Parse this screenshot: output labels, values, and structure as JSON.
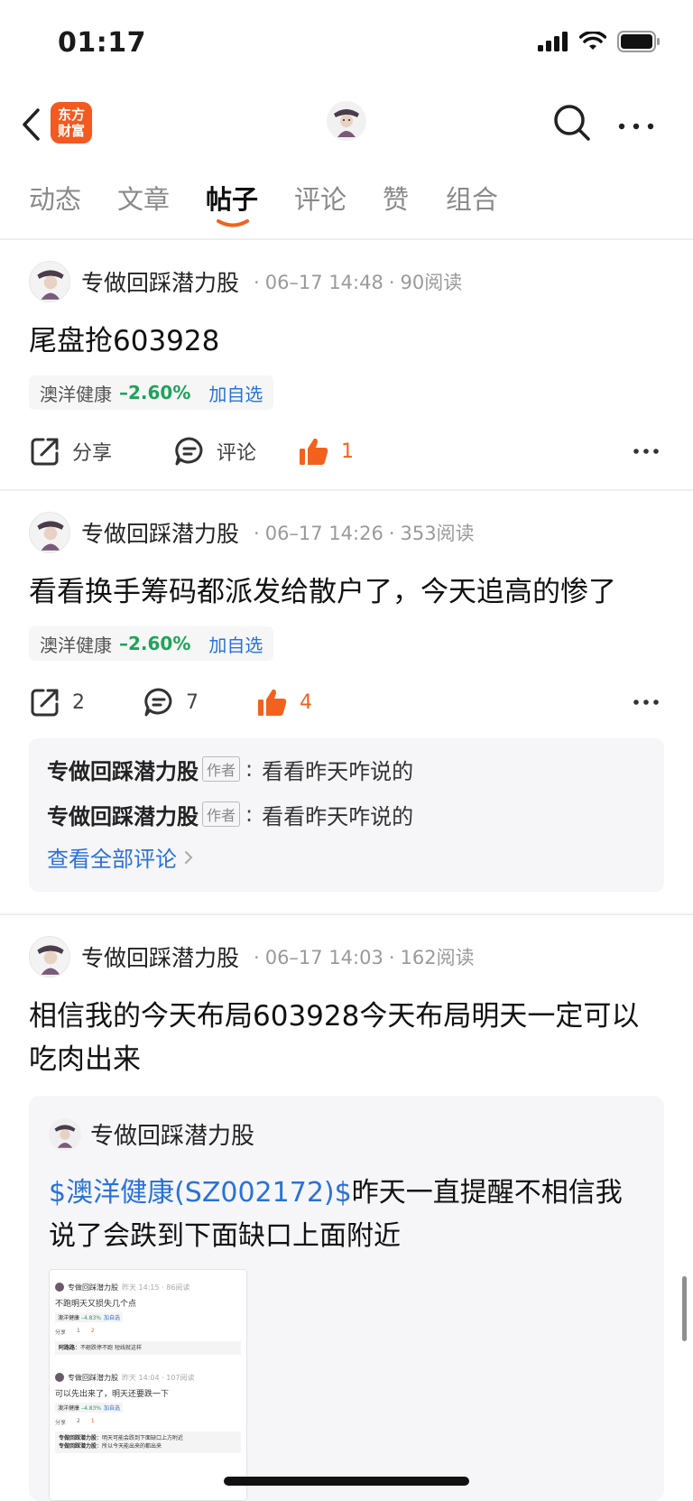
{
  "status_bar": {
    "time": "01:17"
  },
  "nav": {
    "logo_line1": "东方",
    "logo_line2": "财富",
    "brand_color": "#f25a1f"
  },
  "tabs": [
    {
      "label": "动态",
      "active": false
    },
    {
      "label": "文章",
      "active": false
    },
    {
      "label": "帖子",
      "active": true
    },
    {
      "label": "评论",
      "active": false
    },
    {
      "label": "赞",
      "active": false
    },
    {
      "label": "组合",
      "active": false
    }
  ],
  "posts": [
    {
      "author": "专做回踩潜力股",
      "time": "06–17 14:48",
      "reads": "90阅读",
      "text": "尾盘抢603928",
      "stock": {
        "name": "澳洋健康",
        "change": "–2.60%",
        "add": "加自选"
      },
      "actions": {
        "share": "分享",
        "comment": "评论",
        "like": "1"
      }
    },
    {
      "author": "专做回踩潜力股",
      "time": "06–17 14:26",
      "reads": "353阅读",
      "text": "看看换手筹码都派发给散户了，今天追高的惨了",
      "stock": {
        "name": "澳洋健康",
        "change": "–2.60%",
        "add": "加自选"
      },
      "actions": {
        "share": "2",
        "comment": "7",
        "like": "4"
      },
      "comments": [
        {
          "author": "专做回踩潜力股",
          "tag": "作者",
          "colon": ":",
          "text": "看看昨天咋说的"
        },
        {
          "author": "专做回踩潜力股",
          "tag": "作者",
          "colon": ":",
          "text": "看看昨天咋说的"
        }
      ],
      "view_all": "查看全部评论"
    },
    {
      "author": "专做回踩潜力股",
      "time": "06–17 14:03",
      "reads": "162阅读",
      "text": "相信我的今天布局603928今天布局明天一定可以吃肉出来",
      "quote": {
        "author": "专做回踩潜力股",
        "link": "$澳洋健康(SZ002172)$",
        "text": "昨天一直提醒不相信我说了会跌到下面缺口上面附近"
      }
    }
  ],
  "thumbnail": {
    "items": [
      {
        "author": "专做回踩潜力股",
        "time": "昨天 14:15 · 86阅读",
        "title": "不跑明天又损失几个点",
        "stock": "澳洋健康",
        "change": "–4.83%",
        "add": "加自选",
        "share": "分享",
        "comment": "1",
        "like": "2",
        "c_author": "阿路路",
        "c_text": "不砸跌停不跑 短线就这样"
      },
      {
        "author": "专做回踩潜力股",
        "time": "昨天 14:04 · 107阅读",
        "title": "可以先出来了，明天还要跌一下",
        "stock": "澳洋健康",
        "change": "–4.83%",
        "add": "加自选",
        "share": "分享",
        "comment": "2",
        "like": "1",
        "c_author": "专做回踩潜力股",
        "c_text": "明天可能会跌到下面缺口上方附近",
        "c_author2": "专做回踩潜力股",
        "c_text2": "所以今天能出来的都出来"
      }
    ]
  },
  "colors": {
    "green": "#1fa35a",
    "blue_link": "#2a72d9",
    "like_orange": "#f2621e"
  }
}
